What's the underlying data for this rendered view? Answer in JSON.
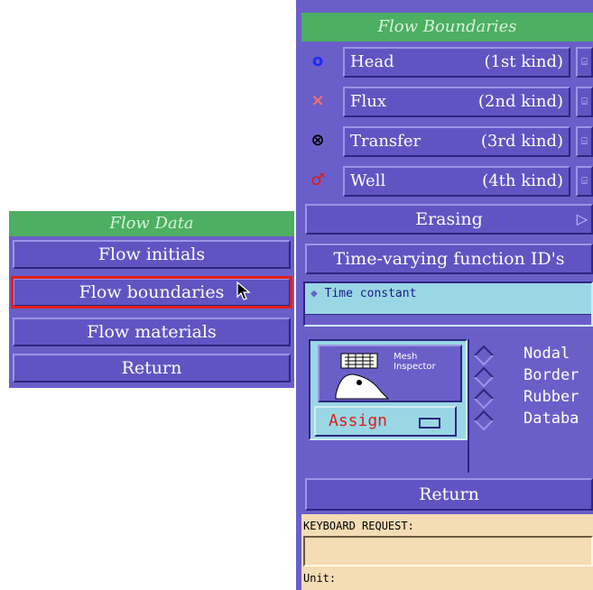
{
  "flow_data": {
    "title": "Flow Data",
    "items": [
      {
        "label": "Flow initials"
      },
      {
        "label": "Flow boundaries"
      },
      {
        "label": "Flow materials"
      },
      {
        "label": "Return"
      }
    ],
    "selected_index": 1,
    "highlight_color": "#e0201c"
  },
  "flow_boundaries": {
    "title": "Flow Boundaries",
    "kinds": [
      {
        "name": "Head",
        "kind": "(1st kind)",
        "icon": "circle-icon",
        "glyph": "o",
        "color": "#1b2cff"
      },
      {
        "name": "Flux",
        "kind": "(2nd kind)",
        "icon": "cross-icon",
        "glyph": "×",
        "color": "#f07070"
      },
      {
        "name": "Transfer",
        "kind": "(3rd kind)",
        "icon": "circled-cross-icon",
        "glyph": "⊗",
        "color": "#000000"
      },
      {
        "name": "Well",
        "kind": "(4th kind)",
        "icon": "well-icon",
        "glyph": "♂",
        "color": "#e01818"
      }
    ],
    "erasing_label": "Erasing",
    "time_varying_label": "Time-varying function ID's",
    "time_constant_label": "Time constant",
    "mesh_label_1": "Mesh",
    "mesh_label_2": "Inspector",
    "assign_label": "Assign",
    "radio_options": [
      {
        "label": "Nodal"
      },
      {
        "label": "Border"
      },
      {
        "label": "Rubber"
      },
      {
        "label": "Databa"
      }
    ],
    "return_label": "Return"
  },
  "keyboard": {
    "request_label": "KEYBOARD REQUEST:",
    "value": "",
    "unit_label": "Unit:"
  },
  "colors": {
    "panel": "#6a5fc9",
    "title_bar": "#4caf61",
    "field": "#9ad7e4",
    "keyboard_bg": "#f4dcb4"
  }
}
